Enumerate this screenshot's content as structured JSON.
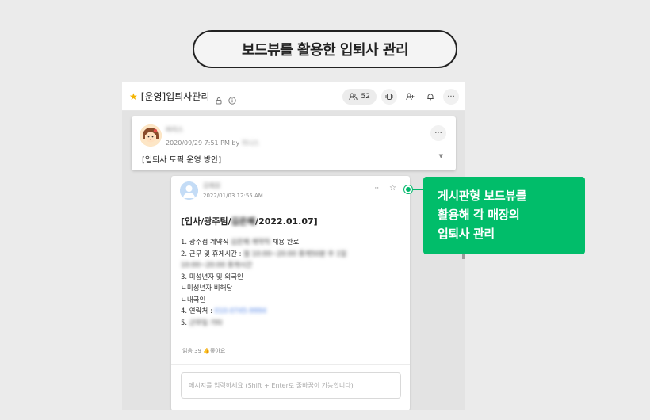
{
  "title_pill": "보드뷰를 활용한 입퇴사 관리",
  "topbar": {
    "room_title": "[운영]입퇴사관리",
    "member_count": "52"
  },
  "notice": {
    "author": "바리스",
    "datetime": "2020/09/29 7:51 PM by",
    "by_name": "지니스",
    "text": "[입퇴사 토픽 운영 방안]"
  },
  "post": {
    "author": "김예원",
    "datetime": "2022/01/03 12:55 AM",
    "heading_prefix": "[입사/광주팀/",
    "heading_name": "김은혜",
    "heading_suffix": "/2022.01.07]",
    "lines": [
      {
        "text": "1. 광주점 계약직",
        "blur": "김은혜 계약직",
        "after": "채용 완료"
      },
      {
        "text": "2. 근무 및 휴게시간 :",
        "blur": "월 10:00~20:00 휴게50분 주 1일",
        "after": ""
      },
      {
        "text": "",
        "blur": "10:00~20:00 휴게시간",
        "after": ""
      },
      {
        "text": "3. 미성년자 및 외국인",
        "blur": "",
        "after": ""
      },
      {
        "text": "ㄴ미성년자 비해당",
        "blur": "",
        "after": ""
      },
      {
        "text": "ㄴ내국인",
        "blur": "",
        "after": ""
      },
      {
        "text": "4. 연락처 :",
        "blur": "010-0745-9994",
        "after": ""
      },
      {
        "text": "5.",
        "blur": "근무일 기타",
        "after": ""
      }
    ],
    "stats": "읽음 39",
    "like_label": "좋아요",
    "input_placeholder": "메시지를 입력하세요 (Shift + Enter로 줄바꿈이 가능합니다)"
  },
  "callout": {
    "lines": [
      "게시판형 보드뷰를",
      "활용해 각 매장의",
      "입퇴사 관리"
    ]
  },
  "colors": {
    "accent_green": "#01bd6a",
    "star_yellow": "#f3b400",
    "link_blue": "#4f82e6"
  }
}
